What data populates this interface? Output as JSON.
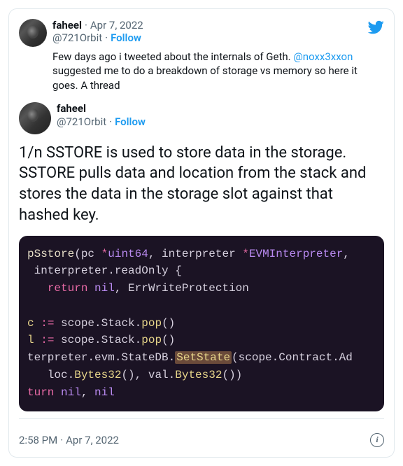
{
  "quoted": {
    "display_name": "faheel",
    "date": "Apr 7, 2022",
    "handle": "@721Orbit",
    "follow": "Follow",
    "body_1": "Few days ago i tweeted about the internals of Geth. ",
    "mention": "@noxx3xxon",
    "body_2": " suggested me to do a breakdown of storage vs memory so here it goes. A thread"
  },
  "main": {
    "display_name": "faheel",
    "handle": "@721Orbit",
    "follow": "Follow",
    "text": "1/n SSTORE is used to store data in the storage. SSTORE pulls data and location from the stack and stores the data in the storage slot against that hashed key."
  },
  "code": {
    "l1a": "pSstore",
    "l1b": "(pc ",
    "l1c": "*",
    "l1d": "uint64",
    "l1e": ", interpreter ",
    "l1f": "*",
    "l1g": "EVMInterpreter",
    "l1h": ",",
    "l2a": " interpreter.readOnly {",
    "l3a": "   ",
    "l3b": "return",
    "l3c": " ",
    "l3d": "nil",
    "l3e": ", ErrWriteProtection",
    "l5a": "c",
    "l5b": " ",
    "l5c": ":=",
    "l5d": " scope.Stack.",
    "l5e": "pop",
    "l5f": "()",
    "l6a": "l",
    "l6b": " ",
    "l6c": ":=",
    "l6d": " scope.Stack.",
    "l6e": "pop",
    "l6f": "()",
    "l7a": "terpreter.evm.StateDB.",
    "l7b": "SetState",
    "l7c": "(scope.Contract.Ad",
    "l8a": "   loc.",
    "l8b": "Bytes32",
    "l8c": "(), val.",
    "l8d": "Bytes32",
    "l8e": "())",
    "l9a": "turn",
    "l9b": " ",
    "l9c": "nil",
    "l9d": ", ",
    "l9e": "nil"
  },
  "footer": {
    "time": "2:58 PM",
    "sep": "·",
    "date": "Apr 7, 2022"
  }
}
